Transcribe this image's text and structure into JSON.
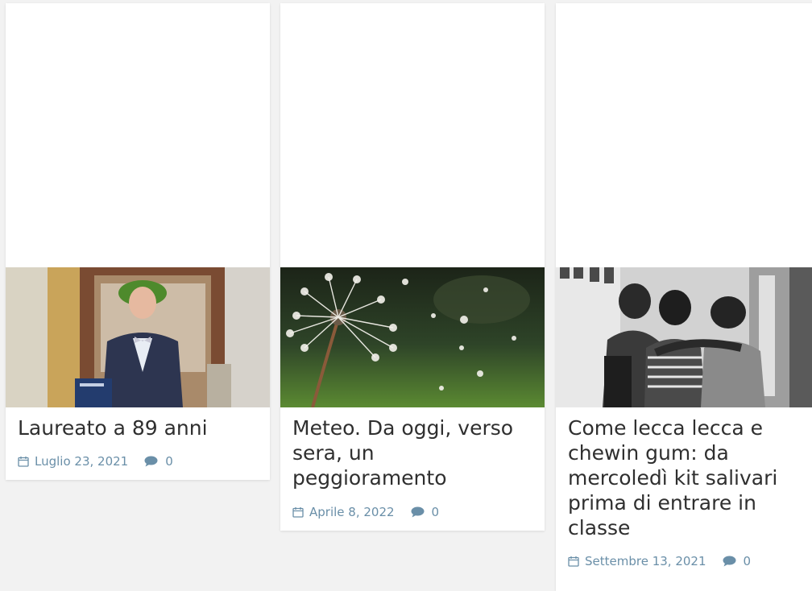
{
  "colors": {
    "page_background": "#f2f2f2",
    "card_background": "#ffffff",
    "title_text": "#2f2f2f",
    "meta_text": "#6a8fa8"
  },
  "posts": [
    {
      "title": "Laureato a 89 anni",
      "date": "Luglio 23, 2021",
      "comments": "0",
      "image_subject": "elderly graduate with laurel wreath holding diploma",
      "icons": [
        "calendar-icon",
        "comment-icon"
      ]
    },
    {
      "title": "Meteo. Da oggi, verso sera, un peggioramento",
      "date": "Aprile 8, 2022",
      "comments": "0",
      "image_subject": "dandelion seed head against green background",
      "icons": [
        "calendar-icon",
        "comment-icon"
      ]
    },
    {
      "title": "Come lecca lecca e chewin gum: da mercoledì kit salivari prima di entrare in classe",
      "date": "Settembre 13, 2021",
      "comments": "0",
      "image_subject": "students in school corridor, black and white",
      "icons": [
        "calendar-icon",
        "comment-icon"
      ]
    }
  ]
}
